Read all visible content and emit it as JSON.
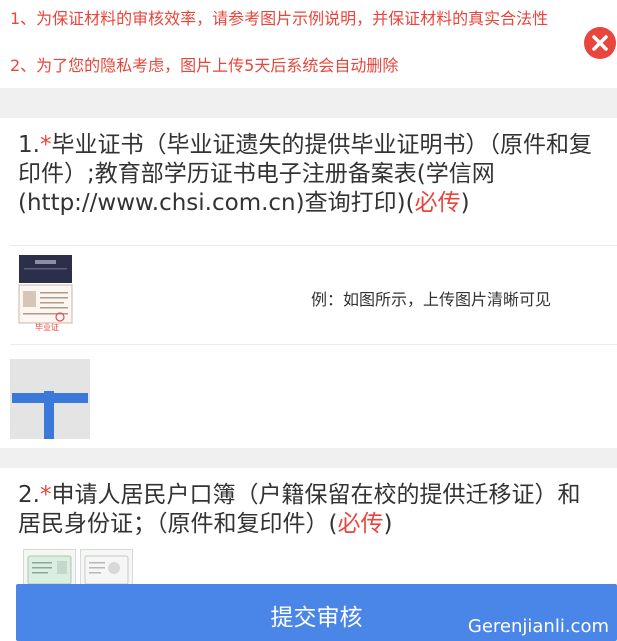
{
  "notice": {
    "line1": "1、为保证材料的审核效率，请参考图片示例说明，并保证材料的真实合法性",
    "line2": "2、为了您的隐私考虑，图片上传5天后系统会自动删除",
    "close_icon": "close-icon",
    "accent_color": "#e8453c"
  },
  "section1": {
    "number": "1.",
    "star": "*",
    "title": "毕业证书（毕业证遗失的提供毕业证明书）（原件和复印件）;教育部学历证书电子注册备案表(学信网(http://www.chsi.com.cn)查询打印)(",
    "required": "必传",
    "close_paren": ")",
    "sample_caption": "毕业证",
    "sample_hint": "例：如图所示，上传图片清晰可见",
    "upload_icon": "plus-icon"
  },
  "section2": {
    "number": "2.",
    "star": "*",
    "title": "申请人居民户口簿（户籍保留在校的提供迁移证）和居民身份证；（原件和复印件）(",
    "required": "必传",
    "close_paren": ")"
  },
  "submit": {
    "label": "提交审核",
    "color": "#4a86e8"
  },
  "watermark": "Gerenjianli.com"
}
